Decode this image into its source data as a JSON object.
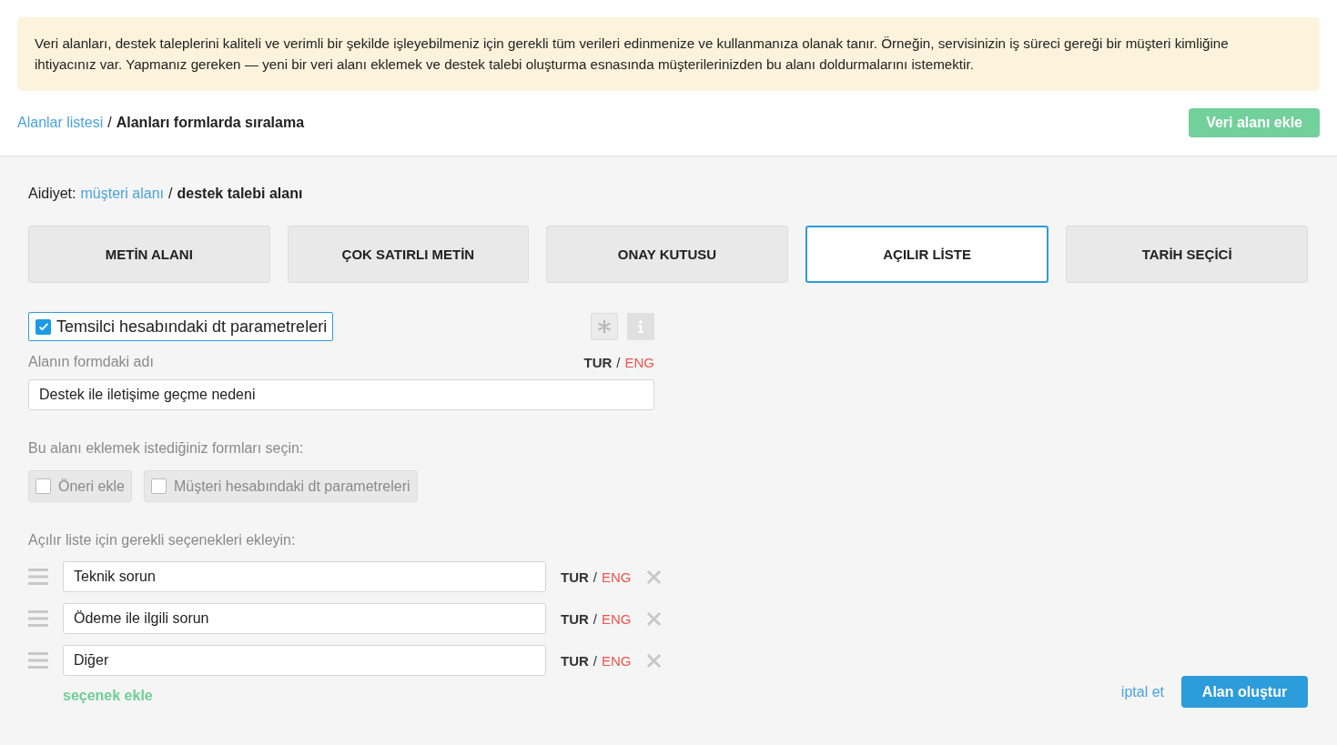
{
  "notice": "Veri alanları, destek taleplerini kaliteli ve verimli bir şekilde işleyebilmeniz için gerekli tüm verileri edinmenize ve kullanmanıza olanak tanır. Örneğin, servisinizin iş süreci gereği bir müşteri kimliğine ihtiyacınız var. Yapmanız gereken — yeni bir veri alanı eklemek ve destek talebi oluşturma esnasında müşterilerinizden bu alanı doldurmalarını istemektir.",
  "breadcrumb": {
    "link": "Alanlar listesi",
    "separator": "/",
    "current": "Alanları formlarda sıralama"
  },
  "add_button": "Veri alanı ekle",
  "ownership": {
    "label": "Aidiyet:",
    "link": "müşteri alanı",
    "separator": "/",
    "current": "destek talebi alanı"
  },
  "tabs": [
    {
      "label": "METİN ALANI",
      "selected": false
    },
    {
      "label": "ÇOK SATIRLI METİN",
      "selected": false
    },
    {
      "label": "ONAY KUTUSU",
      "selected": false
    },
    {
      "label": "AÇILIR LİSTE",
      "selected": true
    },
    {
      "label": "TARİH SEÇİCİ",
      "selected": false
    }
  ],
  "agent_checkbox": {
    "label": "Temsilci hesabındaki dt parametreleri",
    "checked": true
  },
  "field_name": {
    "label": "Alanın formdaki adı",
    "value": "Destek ile iletişime geçme nedeni",
    "languages": [
      {
        "label": "TUR",
        "selected": true
      },
      {
        "label": "ENG",
        "selected": false
      }
    ],
    "separator": "/"
  },
  "forms": {
    "label": "Bu alanı eklemek istediğiniz formları seçin:",
    "options": [
      {
        "label": "Öneri ekle",
        "checked": false,
        "disabled": true
      },
      {
        "label": "Müşteri hesabındaki dt parametreleri",
        "checked": false,
        "disabled": true
      }
    ]
  },
  "options": {
    "label": "Açılır liste için gerekli seçenekleri ekleyin:",
    "items": [
      {
        "value": "Teknik sorun",
        "languages": [
          {
            "label": "TUR",
            "selected": true
          },
          {
            "label": "ENG",
            "selected": false
          }
        ],
        "separator": "/"
      },
      {
        "value": "Ödeme ile ilgili sorun",
        "languages": [
          {
            "label": "TUR",
            "selected": true
          },
          {
            "label": "ENG",
            "selected": false
          }
        ],
        "separator": "/"
      },
      {
        "value": "Diğer",
        "languages": [
          {
            "label": "TUR",
            "selected": true
          },
          {
            "label": "ENG",
            "selected": false
          }
        ],
        "separator": "/"
      }
    ],
    "add_link": "seçenek ekle"
  },
  "cancel": "iptal et",
  "submit": "Alan oluştur"
}
